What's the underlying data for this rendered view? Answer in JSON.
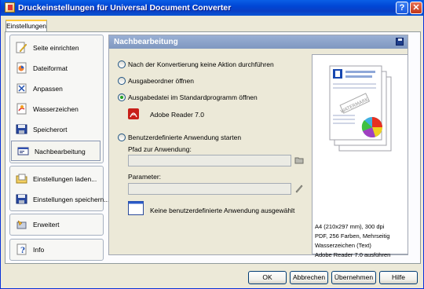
{
  "window": {
    "title": "Druckeinstellungen für Universal Document Converter",
    "help_label": "?",
    "close_label": "✕"
  },
  "tab": {
    "label": "Einstellungen"
  },
  "nav": {
    "group1": [
      {
        "label": "Seite einrichten",
        "icon": "pencil-page-icon"
      },
      {
        "label": "Dateiformat",
        "icon": "file-format-icon"
      },
      {
        "label": "Anpassen",
        "icon": "adjust-icon"
      },
      {
        "label": "Wasserzeichen",
        "icon": "watermark-icon"
      },
      {
        "label": "Speicherort",
        "icon": "save-location-icon"
      },
      {
        "label": "Nachbearbeitung",
        "icon": "post-processing-icon",
        "active": true
      }
    ],
    "group2": [
      {
        "label": "Einstellungen laden...",
        "icon": "load-settings-icon"
      },
      {
        "label": "Einstellungen speichern...",
        "icon": "save-settings-icon"
      }
    ],
    "group3": [
      {
        "label": "Erweitert",
        "icon": "advanced-icon"
      }
    ],
    "group4": [
      {
        "label": "Info",
        "icon": "info-icon"
      }
    ]
  },
  "panel": {
    "title": "Nachbearbeitung",
    "options": [
      {
        "label": "Nach der Konvertierung keine Aktion durchführen",
        "checked": false
      },
      {
        "label": "Ausgabeordner öffnen",
        "checked": false
      },
      {
        "label": "Ausgabedatei im Standardprogramm öffnen",
        "checked": true
      },
      {
        "label": "Benutzerdefinierte Anwendung starten",
        "checked": false
      }
    ],
    "default_app": "Adobe Reader 7.0",
    "path_label": "Pfad zur Anwendung:",
    "path_value": "",
    "params_label": "Parameter:",
    "params_value": "",
    "no_app_text": "Keine benutzerdefinierte Anwendung ausgewählt"
  },
  "preview": {
    "watermark_text": "WATERMARK",
    "info": [
      "A4 (210x297 mm), 300 dpi",
      "PDF, 256 Farben, Mehrseitig",
      "Wasserzeichen (Text)",
      "Adobe Reader 7.0 ausführen"
    ]
  },
  "buttons": {
    "ok": "OK",
    "cancel": "Abbrechen",
    "apply": "Übernehmen",
    "help": "Hilfe"
  },
  "colors": {
    "titlebar": "#0046d5",
    "panel_header": "#8aa2c9",
    "active_radio": "#21a121"
  }
}
